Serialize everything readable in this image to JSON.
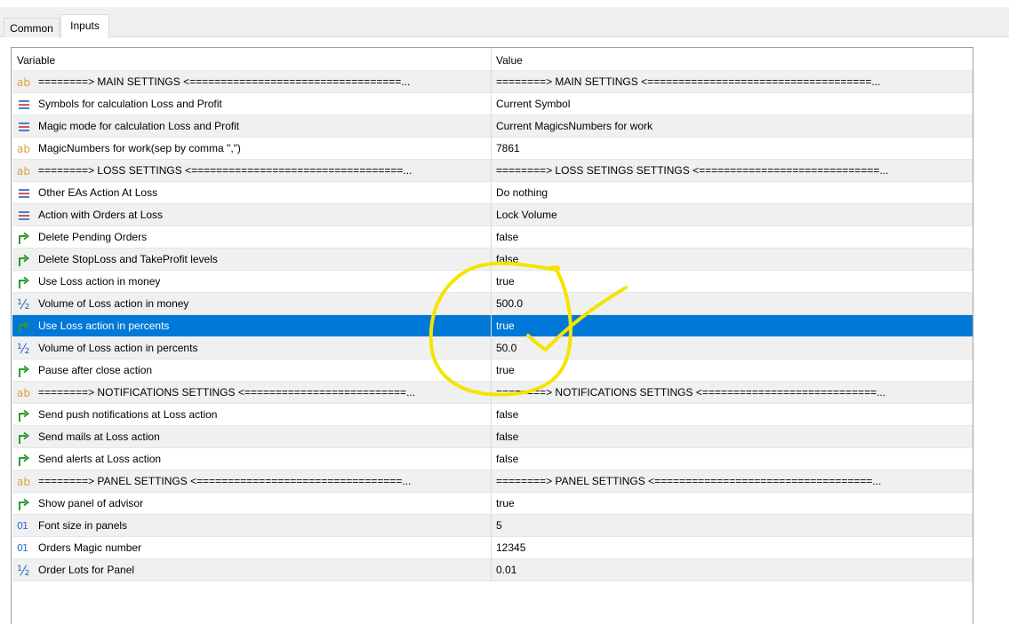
{
  "tabs": [
    {
      "label": "Common",
      "active": false
    },
    {
      "label": "Inputs",
      "active": true
    }
  ],
  "grid": {
    "headers": {
      "variable": "Variable",
      "value": "Value"
    },
    "rows": [
      {
        "icon": "string-icon",
        "variable": "========> MAIN SETTINGS  <==================================...",
        "value": "========> MAIN SETTINGS  <====================================..."
      },
      {
        "icon": "enum-icon",
        "variable": "Symbols for calculation Loss and Profit",
        "value": "Current Symbol"
      },
      {
        "icon": "enum-icon",
        "variable": "Magic mode for calculation Loss and Profit",
        "value": "Current MagicsNumbers for work"
      },
      {
        "icon": "string-icon",
        "variable": "MagicNumbers for work(sep by comma \",\")",
        "value": "7861"
      },
      {
        "icon": "string-icon",
        "variable": "========> LOSS SETTINGS  <==================================...",
        "value": "========> LOSS SETINGS SETTINGS  <=============================..."
      },
      {
        "icon": "enum-icon",
        "variable": "Other EAs Action At Loss",
        "value": "Do nothing"
      },
      {
        "icon": "enum-icon",
        "variable": "Action with Orders at Loss",
        "value": "Lock Volume"
      },
      {
        "icon": "bool-icon",
        "variable": "Delete Pending Orders",
        "value": "false"
      },
      {
        "icon": "bool-icon",
        "variable": "Delete StopLoss and TakeProfit levels",
        "value": "false"
      },
      {
        "icon": "bool-icon",
        "variable": "Use Loss action in money",
        "value": "true"
      },
      {
        "icon": "double-icon",
        "variable": "Volume of Loss action in money",
        "value": "500.0"
      },
      {
        "icon": "bool-icon",
        "variable": "Use Loss action in percents",
        "value": "true",
        "selected": true
      },
      {
        "icon": "double-icon",
        "variable": "Volume of Loss action in percents",
        "value": "50.0"
      },
      {
        "icon": "bool-icon",
        "variable": "Pause after close action",
        "value": "true"
      },
      {
        "icon": "string-icon",
        "variable": "========> NOTIFICATIONS SETTINGS  <==========================...",
        "value": "========> NOTIFICATIONS SETTINGS  <============================..."
      },
      {
        "icon": "bool-icon",
        "variable": "Send push notifications at Loss action",
        "value": "false"
      },
      {
        "icon": "bool-icon",
        "variable": "Send mails at Loss action",
        "value": "false"
      },
      {
        "icon": "bool-icon",
        "variable": "Send alerts at Loss action",
        "value": "false"
      },
      {
        "icon": "string-icon",
        "variable": "========> PANEL SETTINGS  <=================================...",
        "value": "========> PANEL SETTINGS  <===================================..."
      },
      {
        "icon": "bool-icon",
        "variable": "Show panel of advisor",
        "value": "true"
      },
      {
        "icon": "int-icon",
        "variable": "Font size in panels",
        "value": "5"
      },
      {
        "icon": "int-icon",
        "variable": "Orders Magic number",
        "value": "12345"
      },
      {
        "icon": "double-icon",
        "variable": "Order Lots for Panel",
        "value": "0.01"
      }
    ]
  },
  "icon_glyphs": {
    "string": "ab",
    "int": "01",
    "double": "½"
  },
  "colors": {
    "selection": "#0078d7",
    "alt_row": "#f0f0f0",
    "annotation": "#f5e400",
    "bool_icon": "#2e9a2e",
    "enum_blue": "#4a7fd4",
    "enum_red": "#d9534f"
  }
}
